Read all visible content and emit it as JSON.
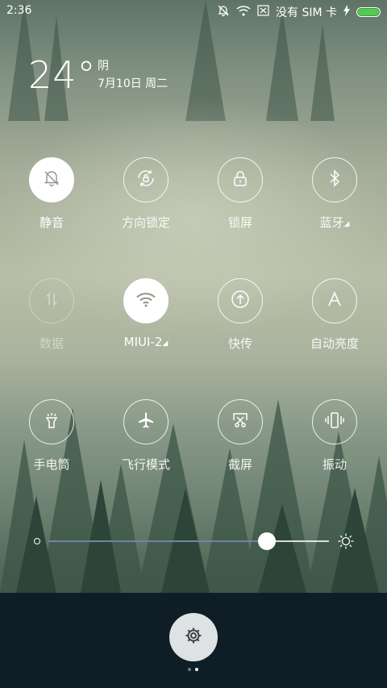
{
  "status_bar": {
    "time": "2:36",
    "carrier": "没有 SIM 卡",
    "icons": [
      "bell-off-icon",
      "wifi-icon",
      "sim-icon",
      "charging-icon",
      "battery-icon"
    ],
    "battery_color": "#4cd04a"
  },
  "weather": {
    "temperature": "24°",
    "condition": "阴",
    "date": "7月10日 周二"
  },
  "toggles": [
    {
      "label": "静音",
      "icon": "bell-off-icon",
      "active": true
    },
    {
      "label": "方向锁定",
      "icon": "rotation-lock-icon",
      "active": false
    },
    {
      "label": "锁屏",
      "icon": "lock-icon",
      "active": false
    },
    {
      "label": "蓝牙",
      "icon": "bluetooth-icon",
      "active": false,
      "has_submenu": true
    },
    {
      "label": "数据",
      "icon": "data-icon",
      "active": false,
      "disabled": true
    },
    {
      "label": "MIUI-2",
      "icon": "wifi-icon",
      "active": true,
      "has_submenu": true
    },
    {
      "label": "快传",
      "icon": "upload-icon",
      "active": false
    },
    {
      "label": "自动亮度",
      "icon": "auto-brightness-icon",
      "active": false
    },
    {
      "label": "手电筒",
      "icon": "flashlight-icon",
      "active": false
    },
    {
      "label": "飞行模式",
      "icon": "airplane-icon",
      "active": false
    },
    {
      "label": "截屏",
      "icon": "screenshot-icon",
      "active": false
    },
    {
      "label": "振动",
      "icon": "vibrate-icon",
      "active": false
    }
  ],
  "brightness": {
    "level": 0.78,
    "accent": "#6c87a3"
  },
  "settings": {
    "icon": "gear-icon"
  },
  "pager": {
    "pages": 2,
    "current": 2
  }
}
